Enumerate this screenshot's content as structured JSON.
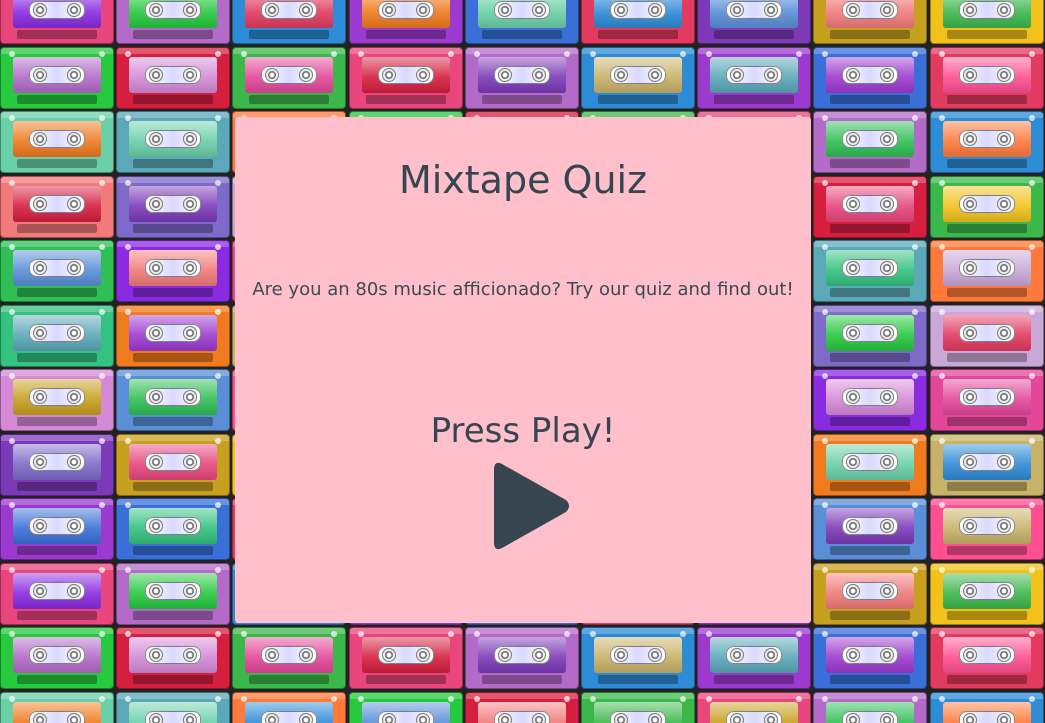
{
  "background": {
    "pattern_icon": "cassette-tape-icon",
    "tape_colors": [
      "#e8467c",
      "#3a6fd8",
      "#f2c21b",
      "#33c27f",
      "#8a2be2",
      "#c9a8d8",
      "#27c93f",
      "#b46ac9",
      "#e33a5f",
      "#d58ad8",
      "#f07a1e",
      "#e4479a",
      "#6ad0a8",
      "#d61f3f",
      "#2e8bd6",
      "#7c3ab8",
      "#5a8fd8",
      "#c9b268",
      "#f27a7a",
      "#5aa8b8",
      "#3cb84b",
      "#9c3ad0",
      "#c8a020",
      "#ff4f92",
      "#2fbf55",
      "#7d6ac9",
      "#ff7a3a"
    ]
  },
  "card": {
    "background": "#ffc0cb",
    "text_color": "#36454f",
    "title": "Mixtape Quiz",
    "intro": "Are you an 80s music afficionado? Try our quiz and find out!",
    "press_play_label": "Press Play!",
    "play_icon": "play-icon"
  }
}
